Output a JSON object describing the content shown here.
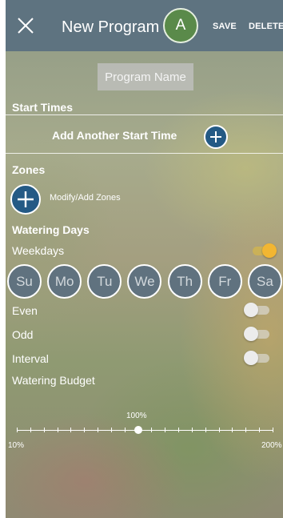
{
  "header": {
    "title": "New Program",
    "avatar_letter": "A",
    "save_label": "SAVE",
    "delete_label": "DELETE",
    "close_icon": "close-icon"
  },
  "program_name": {
    "placeholder": "Program Name",
    "value": ""
  },
  "start_times": {
    "label": "Start Times",
    "add_label": "Add Another Start Time"
  },
  "zones": {
    "label": "Zones",
    "modify_label": "Modify/Add Zones"
  },
  "watering_days": {
    "label": "Watering Days",
    "weekdays_label": "Weekdays",
    "weekdays_on": true,
    "days": [
      "Su",
      "Mo",
      "Tu",
      "We",
      "Th",
      "Fr",
      "Sa"
    ],
    "even_label": "Even",
    "even_on": false,
    "odd_label": "Odd",
    "odd_on": false,
    "interval_label": "Interval",
    "interval_on": false
  },
  "budget": {
    "label": "Watering Budget",
    "value_label": "100%",
    "min_label": "10%",
    "max_label": "200%",
    "value": 100,
    "min": 10,
    "max": 200,
    "step": 10
  },
  "colors": {
    "header": "#5e7380",
    "avatar": "#5a8a4a",
    "plus_button": "#245a85",
    "day_button": "#60727f",
    "toggle_on": "#f2b632"
  }
}
